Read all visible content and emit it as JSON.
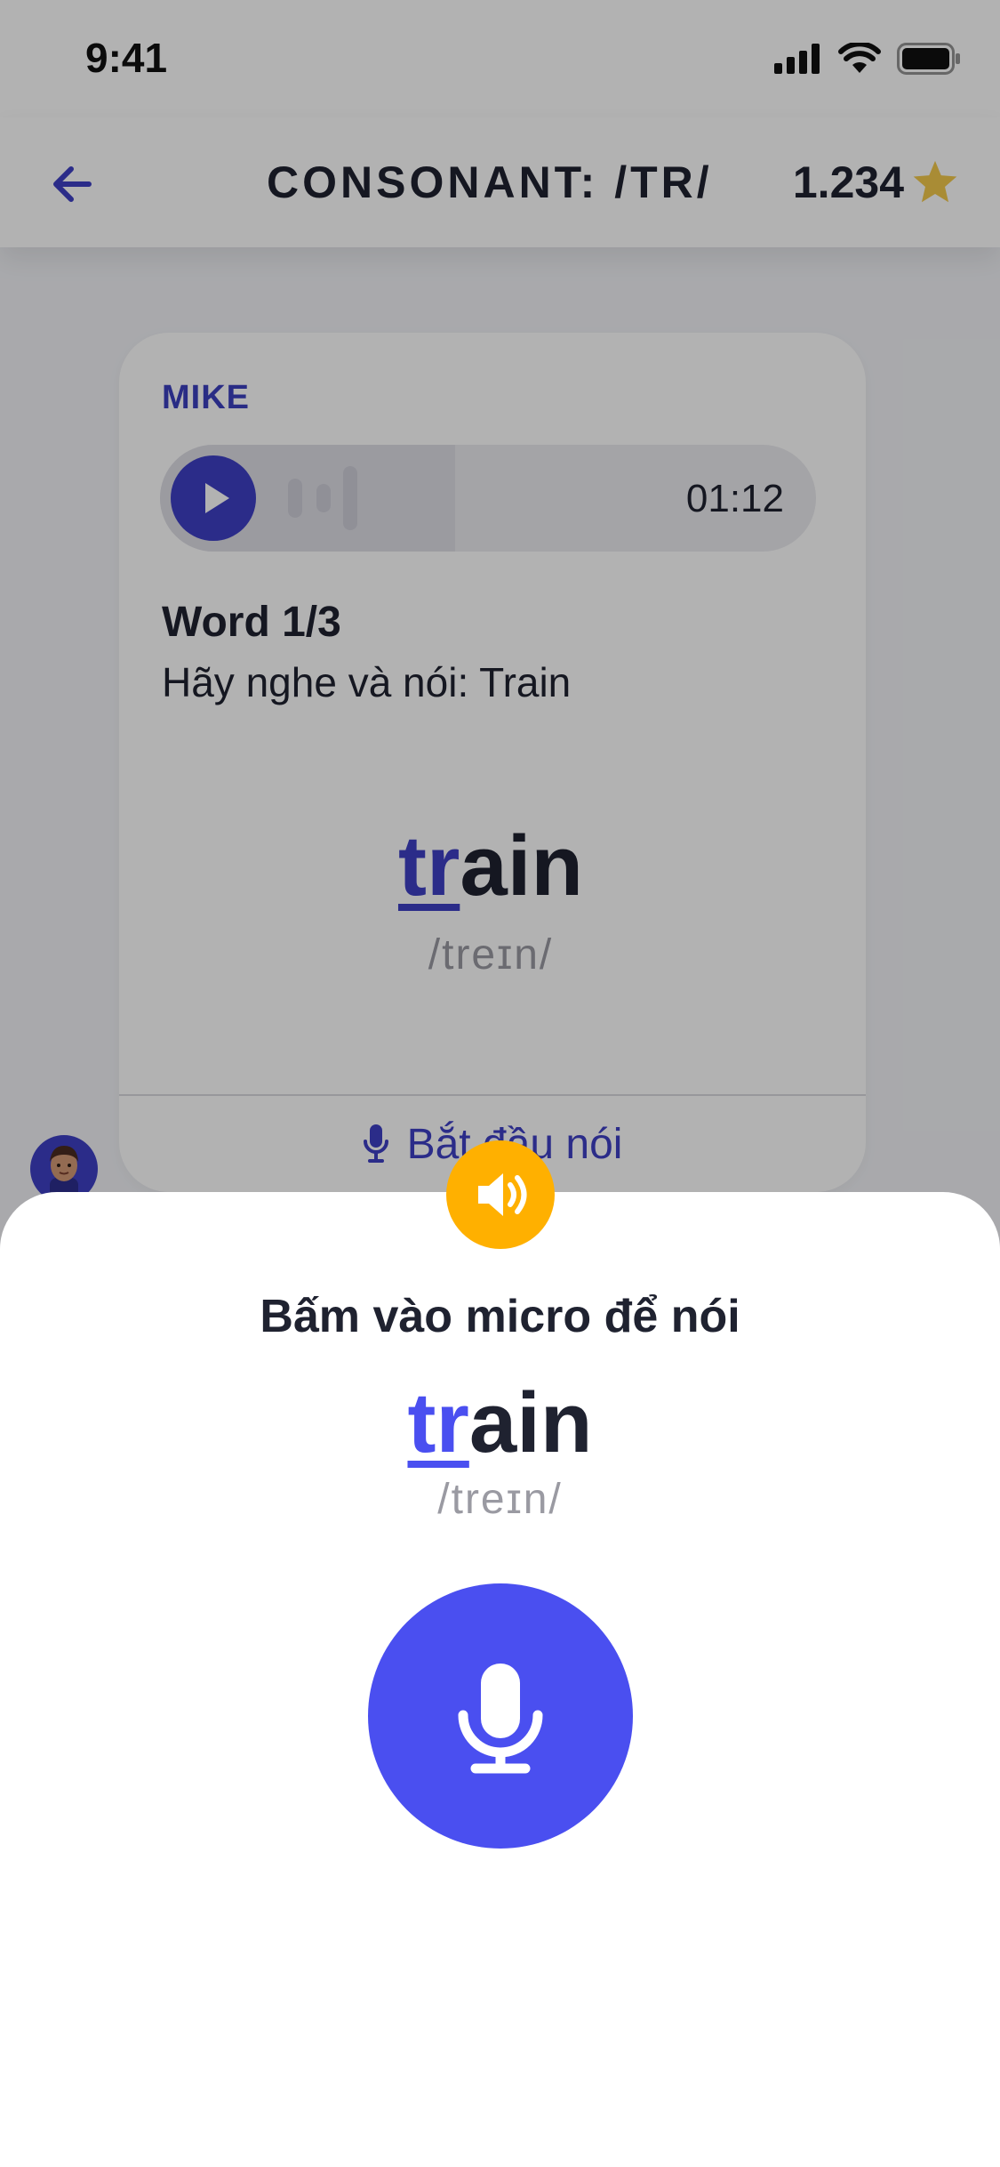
{
  "status_bar": {
    "time": "9:41"
  },
  "header": {
    "title": "CONSONANT: /TR/",
    "score": "1.234"
  },
  "card": {
    "speaker_name": "MIKE",
    "audio": {
      "duration": "01:12",
      "progress": 0.45
    },
    "word_counter": "Word 1/3",
    "instruction": "Hãy nghe và nói: Train",
    "word": {
      "highlight": "tr",
      "rest": "ain",
      "ipa": "/treɪn/"
    },
    "start_button_label": "Bắt đầu nói"
  },
  "sheet": {
    "title": "Bấm vào micro để nói",
    "word": {
      "highlight": "tr",
      "rest": "ain",
      "ipa": "/treɪn/"
    }
  },
  "colors": {
    "primary": "#3E40C4",
    "mic": "#4A4FF0",
    "speaker": "#FFB000",
    "star": "#F2C94C"
  },
  "icons": [
    "back-arrow-icon",
    "star-icon",
    "play-icon",
    "waveform-icon",
    "microphone-icon",
    "speaker-icon",
    "signal-icon",
    "wifi-icon",
    "battery-icon"
  ]
}
